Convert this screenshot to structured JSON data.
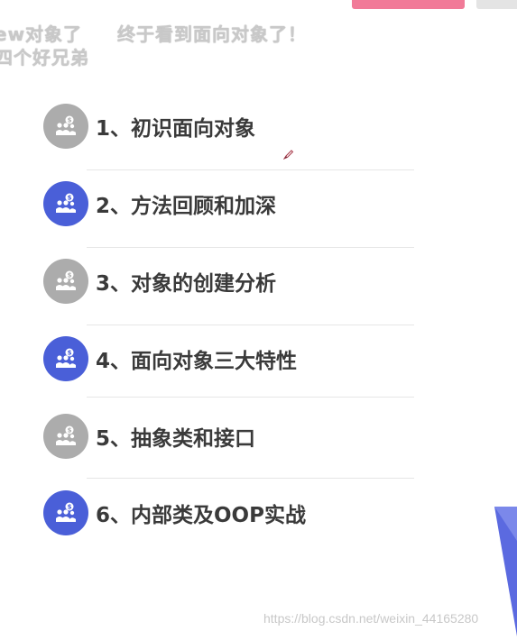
{
  "danmaku": [
    "ew对象了",
    "终于看到面向对象了！",
    "四个好兄弟"
  ],
  "items": [
    {
      "label": "1、初识面向对象",
      "color": "gray",
      "icon": "people-coin-icon"
    },
    {
      "label": "2、方法回顾和加深",
      "color": "blue",
      "icon": "people-coin-icon"
    },
    {
      "label": "3、对象的创建分析",
      "color": "gray",
      "icon": "people-coin-icon"
    },
    {
      "label": "4、面向对象三大特性",
      "color": "blue",
      "icon": "people-coin-icon"
    },
    {
      "label": "5、抽象类和接口",
      "color": "gray",
      "icon": "people-coin-icon"
    },
    {
      "label": "6、内部类及OOP实战",
      "color": "blue",
      "icon": "people-coin-icon"
    }
  ],
  "colors": {
    "gray_circle": "#acacac",
    "blue_circle": "#4a5fd8",
    "pink_button": "#f17a98",
    "text": "#3a3a3a"
  },
  "watermark": "https://blog.csdn.net/weixin_44165280"
}
